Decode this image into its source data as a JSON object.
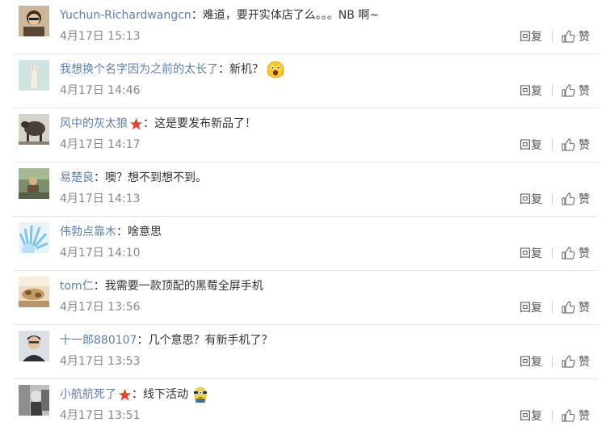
{
  "comments": [
    {
      "user": "Yuchun-Richardwangcn",
      "sep": "：",
      "text": "难道，要开实体店了么。。。NB 啊~",
      "time": "4月17日 15:13",
      "badge": false,
      "emoji": ""
    },
    {
      "user": "我想换个名字因为之前的太长了",
      "sep": "：",
      "text": "新机？",
      "time": "4月17日 14:46",
      "badge": false,
      "emoji": "shocked-face-emoji"
    },
    {
      "user": "风中的灰太狼",
      "sep": "：",
      "text": "这是要发布新品了！",
      "time": "4月17日 14:17",
      "badge": true,
      "emoji": ""
    },
    {
      "user": "易楚良",
      "sep": "：",
      "text": "噢？想不到想不到。",
      "time": "4月17日 14:13",
      "badge": false,
      "emoji": ""
    },
    {
      "user": "伟勃点靠木",
      "sep": "：",
      "text": "啥意思",
      "time": "4月17日 14:10",
      "badge": false,
      "emoji": ""
    },
    {
      "user": "tom仁",
      "sep": "：",
      "text": "我需要一款顶配的黑莓全屏手机",
      "time": "4月17日 13:56",
      "badge": false,
      "emoji": ""
    },
    {
      "user": "十一郎880107",
      "sep": "：",
      "text": "几个意思？有新手机了？",
      "time": "4月17日 13:53",
      "badge": false,
      "emoji": ""
    },
    {
      "user": "小航航死了",
      "sep": "：",
      "text": "线下活动",
      "time": "4月17日 13:51",
      "badge": true,
      "emoji": "minion-emoji"
    }
  ],
  "actions": {
    "reply_label": "回复",
    "like_label": "赞"
  },
  "icons": {
    "badge": "red-star-icon",
    "like": "thumbs-up-icon"
  },
  "colors": {
    "username": "#5d7fb3",
    "text": "#333333",
    "time": "#888888",
    "divider": "#e6e6e6",
    "badge": "#e8432d"
  }
}
